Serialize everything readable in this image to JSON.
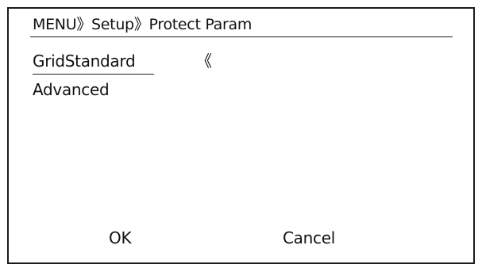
{
  "header": {
    "breadcrumb": "MENU》Setup》Protect Param"
  },
  "menu": {
    "items": [
      {
        "label": "GridStandard",
        "selected": true
      },
      {
        "label": "Advanced",
        "selected": false
      }
    ],
    "cursor_glyph": "《"
  },
  "buttons": {
    "ok_label": "OK",
    "cancel_label": "Cancel"
  }
}
